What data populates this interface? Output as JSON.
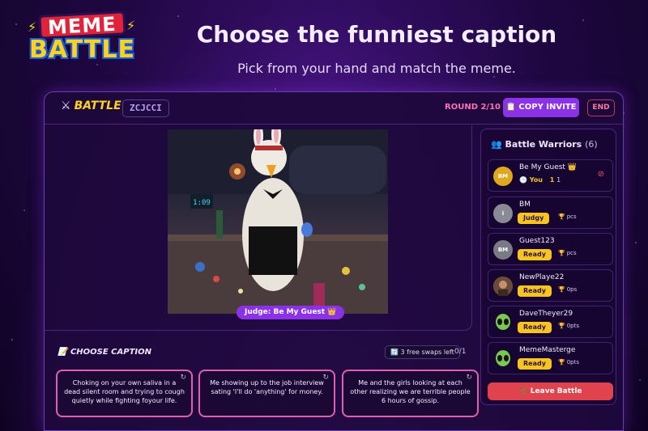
{
  "header": {
    "logo_line1": "MEME",
    "logo_line2": "BATTLE",
    "title": "Choose the funniest caption",
    "subtitle": "Pick from your hand and match the meme."
  },
  "topbar": {
    "brand": "BATTLE",
    "room_code": "ZCJCCI",
    "round": "ROUND 2/10",
    "copy_invite": "📋 COPY INVITE",
    "end": "END"
  },
  "meme": {
    "judge_label": "Judge: Be My Guest 👑"
  },
  "captions": {
    "title": "CHOOSE CAPTION",
    "swaps": "🔄 3 free swaps left",
    "count": "0/1",
    "cards": [
      "Choking on your own saliva in a dead silent room and trying to cough quietly while fighting foyour life.",
      "Me showing up to the job interview sating 'I'll do 'anything' for money.",
      "Me and the girls looking at each other realizing we are terrible people 6 hours of gossip."
    ]
  },
  "sidebar": {
    "title": "Battle Warriors",
    "count": "(6)",
    "leave": "🚪 Leave Battle",
    "players": [
      {
        "initials": "BM",
        "name": "Be My Guest",
        "crown": "👑",
        "status": "You",
        "score": "1",
        "pts": "1"
      },
      {
        "initials": "i",
        "name": "BM",
        "status": "Judgy",
        "pts": "pcs"
      },
      {
        "initials": "BM",
        "name": "Guest123",
        "status": "Ready",
        "pts": "pcs"
      },
      {
        "initials": "",
        "name": "NewPlaye22",
        "status": "Ready",
        "pts": "0ps"
      },
      {
        "initials": "",
        "name": "DaveTheyer29",
        "status": "Ready",
        "pts": "0pts"
      },
      {
        "initials": "",
        "name": "MemeMasterge",
        "status": "Ready",
        "pts": "0pts"
      }
    ]
  }
}
